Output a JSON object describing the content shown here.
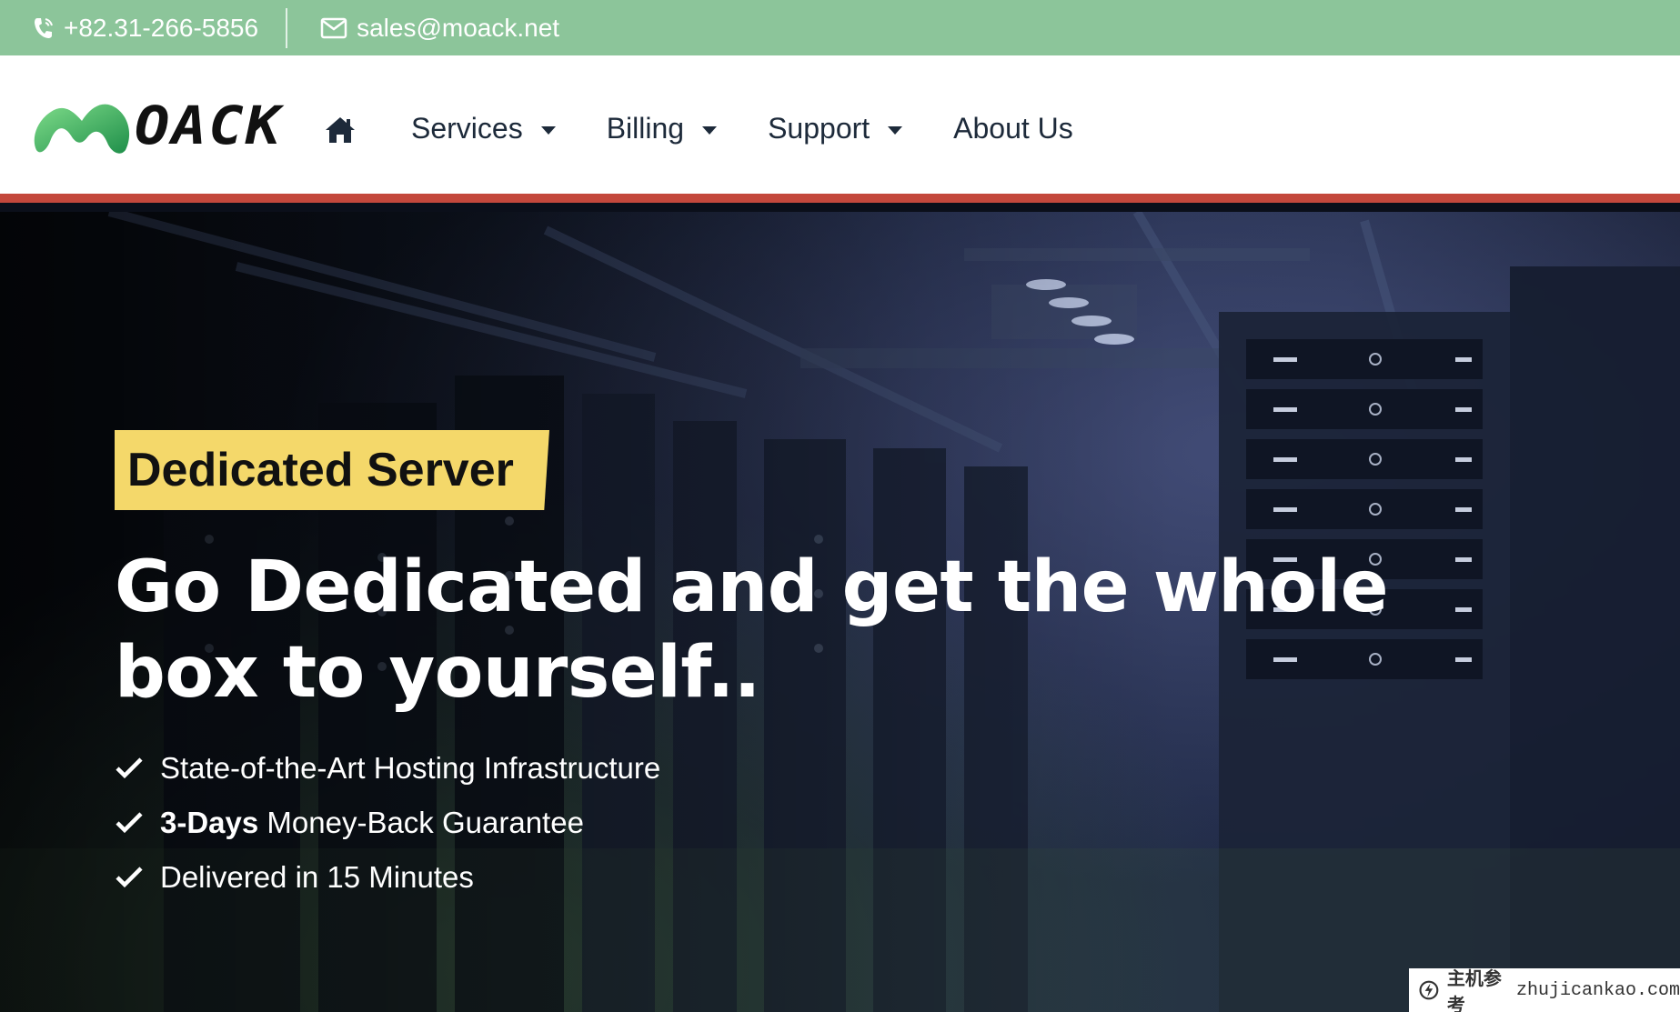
{
  "topbar": {
    "phone": "+82.31-266-5856",
    "email": "sales@moack.net"
  },
  "logo": {
    "wordmark": "OACK",
    "mark_colors": [
      "#1f8f4a",
      "#6ad07e"
    ]
  },
  "nav": {
    "home_icon": "home-icon",
    "items": [
      {
        "label": "Services",
        "dropdown": true
      },
      {
        "label": "Billing",
        "dropdown": true
      },
      {
        "label": "Support",
        "dropdown": true
      },
      {
        "label": "About Us",
        "dropdown": false
      }
    ]
  },
  "hero": {
    "tag": "Dedicated Server",
    "headline_line1": "Go Dedicated and get the whole",
    "headline_line2": "box to yourself..",
    "features": [
      {
        "bold": "",
        "text": "State-of-the-Art Hosting Infrastructure"
      },
      {
        "bold": "3-Days",
        "text": " Money-Back Guarantee"
      },
      {
        "bold": "",
        "text": "Delivered in 15 Minutes"
      }
    ]
  },
  "watermark": {
    "cn": "主机参考",
    "domain": "zhujicankao.com"
  },
  "colors": {
    "topbar": "#8cc59a",
    "accent_line": "#c4483c",
    "tag_bg": "#f4d86a"
  }
}
